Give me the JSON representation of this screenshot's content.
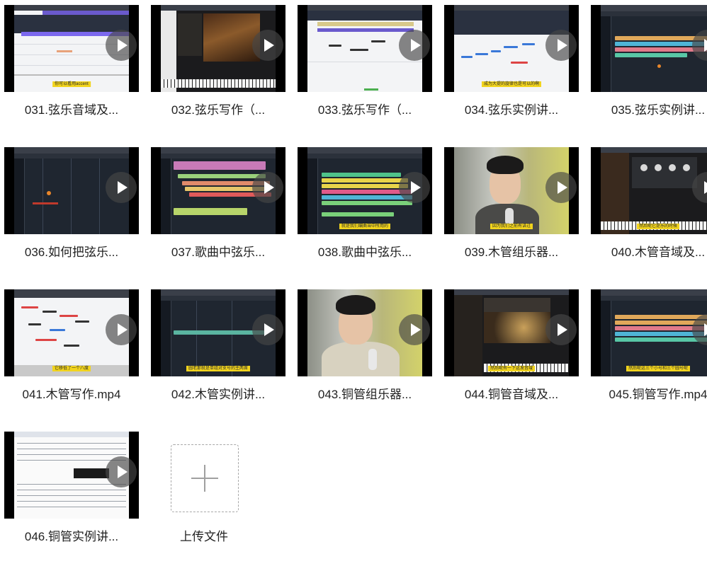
{
  "files": [
    {
      "label": "031.弦乐音域及...",
      "caption": "你可以看用accent"
    },
    {
      "label": "032.弦乐写作（...",
      "caption": ""
    },
    {
      "label": "033.弦乐写作（...",
      "caption": ""
    },
    {
      "label": "034.弦乐实例讲...",
      "caption": "成为大提的旋律也是可以的啊"
    },
    {
      "label": "035.弦乐实例讲...",
      "caption": ""
    },
    {
      "label": "036.如何把弦乐...",
      "caption": ""
    },
    {
      "label": "037.歌曲中弦乐...",
      "caption": ""
    },
    {
      "label": "038.歌曲中弦乐...",
      "caption": "就是我们编曲当中所用的"
    },
    {
      "label": "039.木管组乐器...",
      "caption": "因为我们之前有讲过"
    },
    {
      "label": "040.木管音域及...",
      "caption": "然后呢它是乐的时候"
    },
    {
      "label": "041.木管写作.mp4",
      "caption": "它移低了一个八度"
    },
    {
      "label": "042.木管实例讲...",
      "caption": "圆老那就是单组对支号的主两首"
    },
    {
      "label": "043.铜管组乐器...",
      "caption": ""
    },
    {
      "label": "044.铜管音域及...",
      "caption": "然后呢有一下这发音域"
    },
    {
      "label": "045.铜管写作.mp4",
      "caption": "然后呢这三个小号和三个圆号呢"
    },
    {
      "label": "046.铜管实例讲...",
      "caption": ""
    }
  ],
  "upload": {
    "label": "上传文件",
    "icon": "plus-icon"
  },
  "colors": {
    "play_overlay": "#464646",
    "caption_bg": "#f2d41d",
    "daw_bg": "#1f2630"
  }
}
